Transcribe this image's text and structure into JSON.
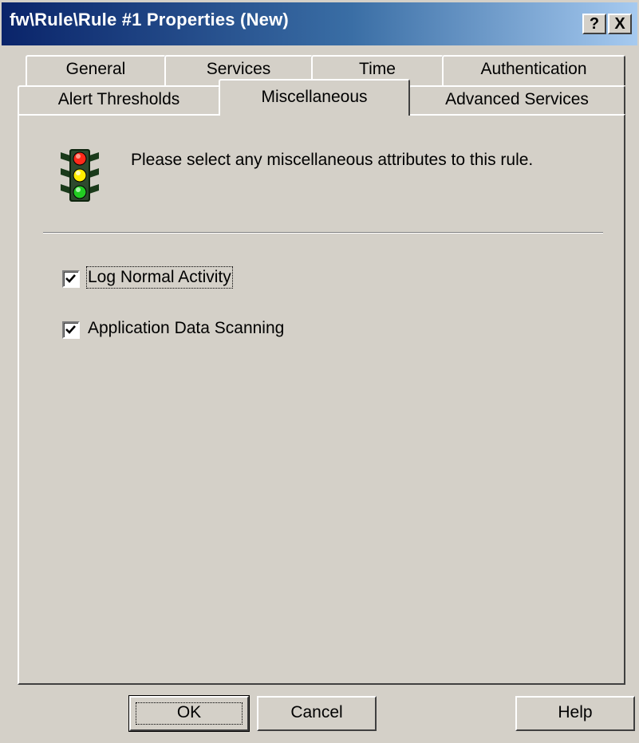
{
  "window": {
    "title": "fw\\Rule\\Rule #1 Properties (New)",
    "help_button": "?",
    "close_button": "X"
  },
  "tabs": {
    "row_back": [
      "General",
      "Services",
      "Time",
      "Authentication"
    ],
    "row_front": [
      "Alert Thresholds",
      "Miscellaneous",
      "Advanced Services"
    ],
    "active": "Miscellaneous"
  },
  "panel": {
    "icon": "traffic-light-icon",
    "intro_text": "Please select any miscellaneous attributes to this rule.",
    "options": [
      {
        "label": "Log Normal Activity",
        "checked": true
      },
      {
        "label": "Application Data Scanning",
        "checked": true
      }
    ]
  },
  "buttons": {
    "ok": "OK",
    "cancel": "Cancel",
    "help": "Help"
  },
  "colors": {
    "titlebar_start": "#0a246a",
    "titlebar_end": "#a6caf0",
    "face": "#d4d0c8"
  }
}
